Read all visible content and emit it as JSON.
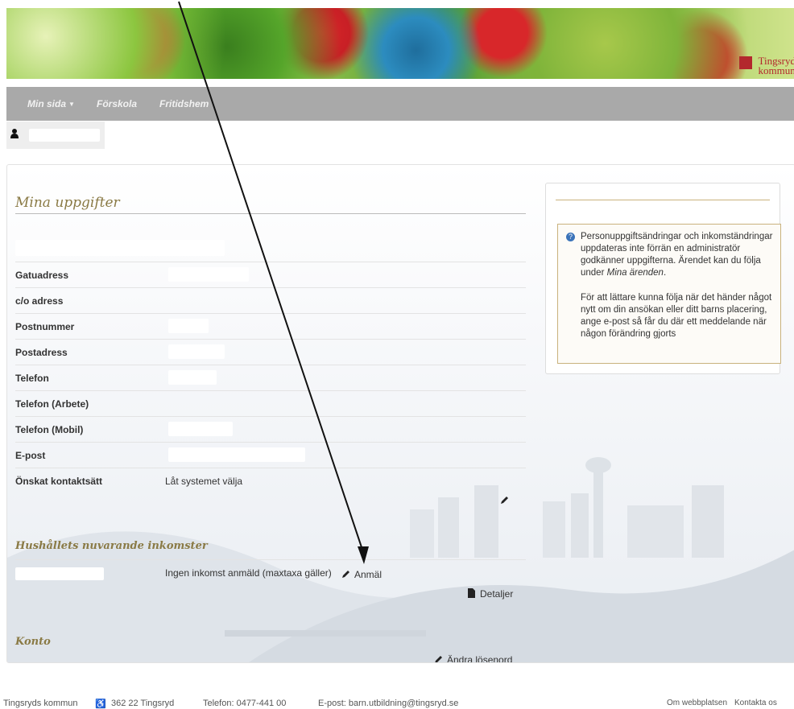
{
  "banner": {
    "logo_line1": "Tingsryd",
    "logo_line2": "kommun"
  },
  "nav": {
    "items": [
      {
        "label": "Min sida"
      },
      {
        "label": "Förskola"
      },
      {
        "label": "Fritidshem"
      }
    ]
  },
  "main": {
    "title": "Mina uppgifter",
    "fields": [
      {
        "label": "Gatuadress",
        "value": ""
      },
      {
        "label": "c/o adress",
        "value": ""
      },
      {
        "label": "Postnummer",
        "value": ""
      },
      {
        "label": "Postadress",
        "value": ""
      },
      {
        "label": "Telefon",
        "value": ""
      },
      {
        "label": "Telefon (Arbete)",
        "value": ""
      },
      {
        "label": "Telefon (Mobil)",
        "value": ""
      },
      {
        "label": "E-post",
        "value": ""
      },
      {
        "label": "Önskat kontaktsätt",
        "value": "Låt systemet välja"
      }
    ],
    "income": {
      "title": "Hushållets nuvarande inkomster",
      "status": "Ingen inkomst anmäld (maxtaxa gäller)",
      "report_label": "Anmäl",
      "details_label": "Detaljer"
    },
    "account": {
      "title": "Konto",
      "change_password_label": "Ändra lösenord"
    }
  },
  "sidebar": {
    "info_p1_a": "Personuppgiftsändringar och inkomständringar uppdateras inte förrän en administratör godkänner uppgifterna. Ärendet kan du följa under ",
    "info_p1_em": "Mina ärenden",
    "info_p1_end": ".",
    "info_p2": "För att lättare kunna följa när det händer något nytt om din ansökan eller ditt barns placering, ange e-post så får du där ett meddelande när någon förändring gjorts"
  },
  "footer": {
    "org": "Tingsryds kommun",
    "address": "362 22 Tingsryd",
    "phone": "Telefon: 0477-441 00",
    "email": "E-post: barn.utbildning@tingsryd.se",
    "about": "Om webbplatsen",
    "contact": "Kontakta os"
  }
}
